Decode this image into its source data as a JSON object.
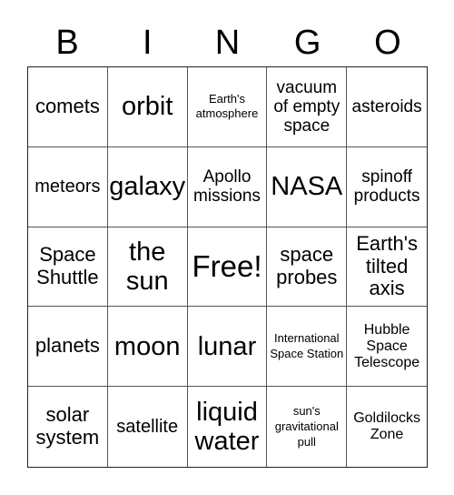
{
  "header": {
    "letters": [
      "B",
      "I",
      "N",
      "G",
      "O"
    ]
  },
  "cells": [
    "comets",
    "orbit",
    "Earth's atmosphere",
    "vacuum of empty space",
    "asteroids",
    "meteors",
    "galaxy",
    "Apollo missions",
    "NASA",
    "spinoff products",
    "Space Shuttle",
    "the sun",
    "Free!",
    "space probes",
    "Earth's tilted axis",
    "planets",
    "moon",
    "lunar",
    "International Space Station",
    "Hubble Space Telescope",
    "solar system",
    "satellite",
    "liquid water",
    "sun's gravitational pull",
    "Goldilocks Zone"
  ]
}
